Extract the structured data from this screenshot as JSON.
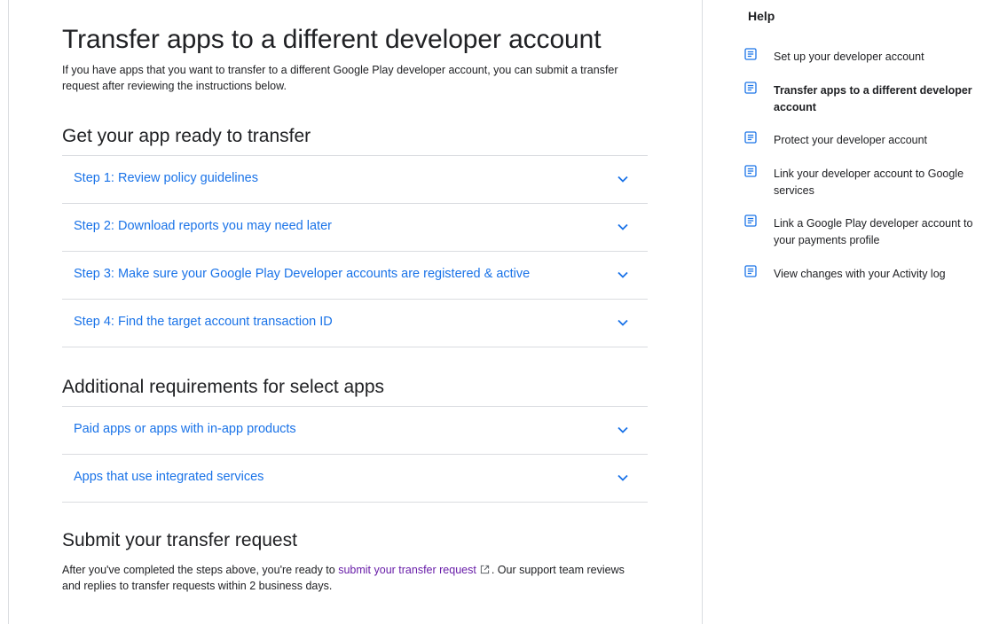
{
  "article": {
    "title": "Transfer apps to a different developer account",
    "intro": "If you have apps that you want to transfer to a different Google Play developer account, you can submit a transfer request after reviewing the instructions below.",
    "sections": [
      {
        "title": "Get your app ready to transfer",
        "items": [
          {
            "label": "Step 1: Review policy guidelines"
          },
          {
            "label": "Step 2: Download reports you may need later"
          },
          {
            "label": "Step 3: Make sure your Google Play Developer accounts are registered & active"
          },
          {
            "label": "Step 4: Find the target account transaction ID"
          }
        ]
      },
      {
        "title": "Additional requirements for select apps",
        "items": [
          {
            "label": "Paid apps or apps with in-app products"
          },
          {
            "label": "Apps that use integrated services"
          }
        ]
      },
      {
        "title": "Submit your transfer request",
        "text_before": "After you've completed the steps above, you're ready to ",
        "link": "submit your transfer request",
        "text_after": ". Our support team reviews and replies to transfer requests within 2 business days."
      }
    ]
  },
  "help": {
    "title": "Help",
    "items": [
      {
        "label": "Set up your developer account",
        "icon": "document-icon"
      },
      {
        "label": "Transfer apps to a different developer account",
        "icon": "document-icon",
        "active": true
      },
      {
        "label": "Protect your developer account",
        "icon": "document-icon"
      },
      {
        "label": "Link your developer account to Google services",
        "icon": "document-icon"
      },
      {
        "label": "Link a Google Play developer account to your payments profile",
        "icon": "document-icon"
      },
      {
        "label": "View changes with your Activity log",
        "icon": "document-icon"
      }
    ]
  },
  "colors": {
    "link": "#1a73e8",
    "visited_link": "#681da8",
    "text": "#202124",
    "divider": "#dadce0"
  }
}
